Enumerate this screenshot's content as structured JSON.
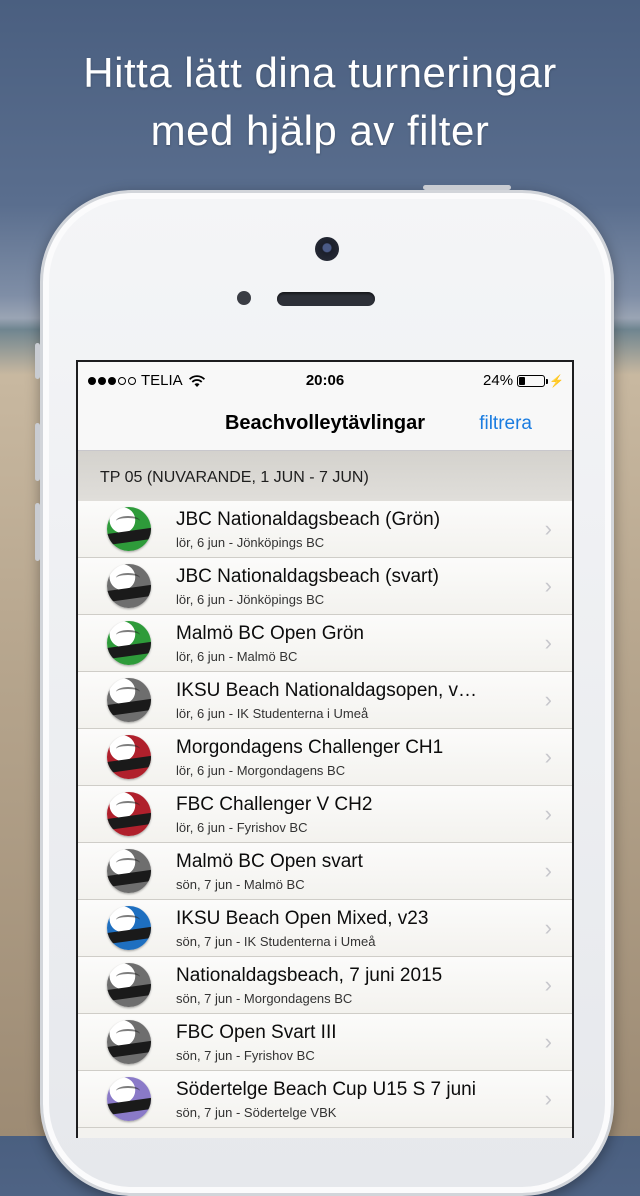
{
  "headline": {
    "line1": "Hitta lätt dina turneringar",
    "line2": "med hjälp av filter"
  },
  "status": {
    "carrier": "TELIA",
    "time": "20:06",
    "battery": "24%",
    "battery_level": 0.24,
    "signal_bars_filled": 3,
    "signal_bars_total": 5
  },
  "nav": {
    "title": "Beachvolleytävlingar",
    "filter_label": "filtrera"
  },
  "section": {
    "label": "TP 05 (NUVARANDE, 1 JUN - 7 JUN)"
  },
  "tournaments": [
    {
      "title": "JBC Nationaldagsbeach (Grön)",
      "subtitle": "lör, 6 jun - Jönköpings BC",
      "ball_color": "#2e9b3a"
    },
    {
      "title": "JBC Nationaldagsbeach (svart)",
      "subtitle": "lör, 6 jun - Jönköpings BC",
      "ball_color": "#6e6e6e"
    },
    {
      "title": "Malmö BC Open Grön",
      "subtitle": "lör, 6 jun - Malmö BC",
      "ball_color": "#2e9b3a"
    },
    {
      "title": "IKSU Beach Nationaldagsopen, v…",
      "subtitle": "lör, 6 jun - IK Studenterna i Umeå",
      "ball_color": "#6e6e6e"
    },
    {
      "title": "Morgondagens Challenger CH1",
      "subtitle": "lör, 6 jun - Morgondagens BC",
      "ball_color": "#b0202c"
    },
    {
      "title": "FBC Challenger V CH2",
      "subtitle": "lör, 6 jun - Fyrishov BC",
      "ball_color": "#b0202c"
    },
    {
      "title": "Malmö BC Open svart",
      "subtitle": "sön, 7 jun - Malmö BC",
      "ball_color": "#6e6e6e"
    },
    {
      "title": "IKSU Beach Open Mixed, v23",
      "subtitle": "sön, 7 jun - IK Studenterna i Umeå",
      "ball_color": "#1e6fc0"
    },
    {
      "title": "Nationaldagsbeach, 7 juni 2015",
      "subtitle": "sön, 7 jun - Morgondagens BC",
      "ball_color": "#6e6e6e"
    },
    {
      "title": "FBC Open Svart III",
      "subtitle": "sön, 7 jun - Fyrishov BC",
      "ball_color": "#6e6e6e"
    },
    {
      "title": "Södertelge Beach Cup U15 S 7 juni",
      "subtitle": "sön, 7 jun - Södertelge VBK",
      "ball_color": "#8a7ac8"
    }
  ]
}
